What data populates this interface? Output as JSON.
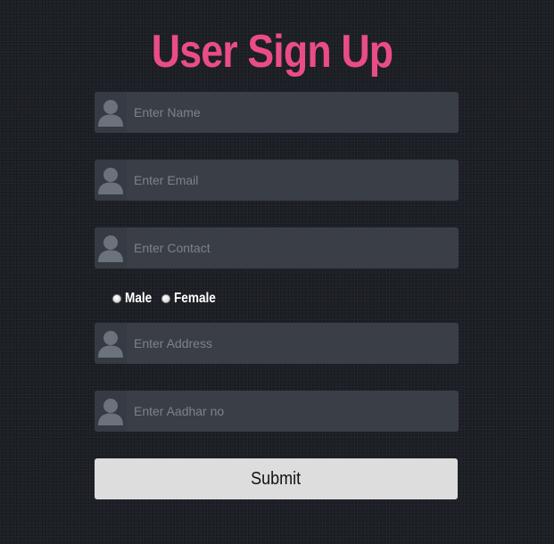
{
  "page": {
    "title": "User Sign Up",
    "title_color": "#ea4c89"
  },
  "form": {
    "fields": [
      {
        "placeholder": "Enter Name",
        "value": "",
        "icon": "user-icon"
      },
      {
        "placeholder": "Enter Email",
        "value": "",
        "icon": "user-icon"
      },
      {
        "placeholder": "Enter Contact",
        "value": "",
        "icon": "user-icon"
      },
      {
        "placeholder": "Enter Address",
        "value": "",
        "icon": "user-icon"
      },
      {
        "placeholder": "Enter Aadhar no",
        "value": "",
        "icon": "user-icon"
      }
    ],
    "gender": {
      "options": [
        "Male",
        "Female"
      ],
      "selected": ""
    },
    "submit_label": "Submit"
  },
  "colors": {
    "background": "#1c1f25",
    "field_background": "#3a3f47",
    "button_background": "#dddddd"
  }
}
